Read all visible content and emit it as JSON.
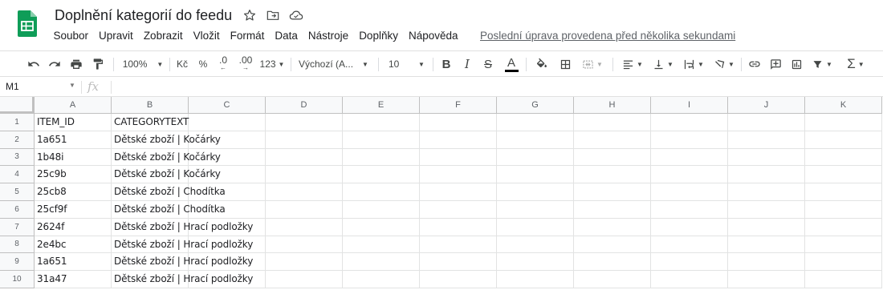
{
  "header": {
    "title": "Doplnění kategorií do feedu",
    "menu": [
      "Soubor",
      "Upravit",
      "Zobrazit",
      "Vložit",
      "Formát",
      "Data",
      "Nástroje",
      "Doplňky",
      "Nápověda"
    ],
    "last_edit": "Poslední úprava provedena před několika sekundami"
  },
  "toolbar": {
    "zoom": "100%",
    "currency": "Kč",
    "percent": "%",
    "decrease_decimals": ".0",
    "increase_decimals": ".00",
    "more_formats": "123",
    "font": "Výchozí (A...",
    "font_size": "10"
  },
  "formula_bar": {
    "cell_ref": "M1",
    "fx": "fx",
    "content": ""
  },
  "grid": {
    "columns": [
      "A",
      "B",
      "C",
      "D",
      "E",
      "F",
      "G",
      "H",
      "I",
      "J",
      "K"
    ],
    "rows": [
      {
        "num": "1",
        "a": "ITEM_ID",
        "b": "CATEGORYTEXT"
      },
      {
        "num": "2",
        "a": "1a651",
        "b": "Dětské zboží | Kočárky"
      },
      {
        "num": "3",
        "a": "1b48i",
        "b": "Dětské zboží | Kočárky"
      },
      {
        "num": "4",
        "a": "25c9b",
        "b": "Dětské zboží | Kočárky"
      },
      {
        "num": "5",
        "a": "25cb8",
        "b": "Dětské zboží | Chodítka"
      },
      {
        "num": "6",
        "a": "25cf9f",
        "b": "Dětské zboží | Chodítka"
      },
      {
        "num": "7",
        "a": "2624f",
        "b": "Dětské zboží | Hrací podložky"
      },
      {
        "num": "8",
        "a": "2e4bc",
        "b": "Dětské zboží | Hrací podložky"
      },
      {
        "num": "9",
        "a": "1a651",
        "b": "Dětské zboží | Hrací podložky"
      },
      {
        "num": "10",
        "a": "31a47",
        "b": "Dětské zboží | Hrací podložky"
      }
    ]
  },
  "colors": {
    "sheets_green": "#0f9d58",
    "header_bg": "#f8f9fa",
    "gridline": "#e2e3e3"
  }
}
